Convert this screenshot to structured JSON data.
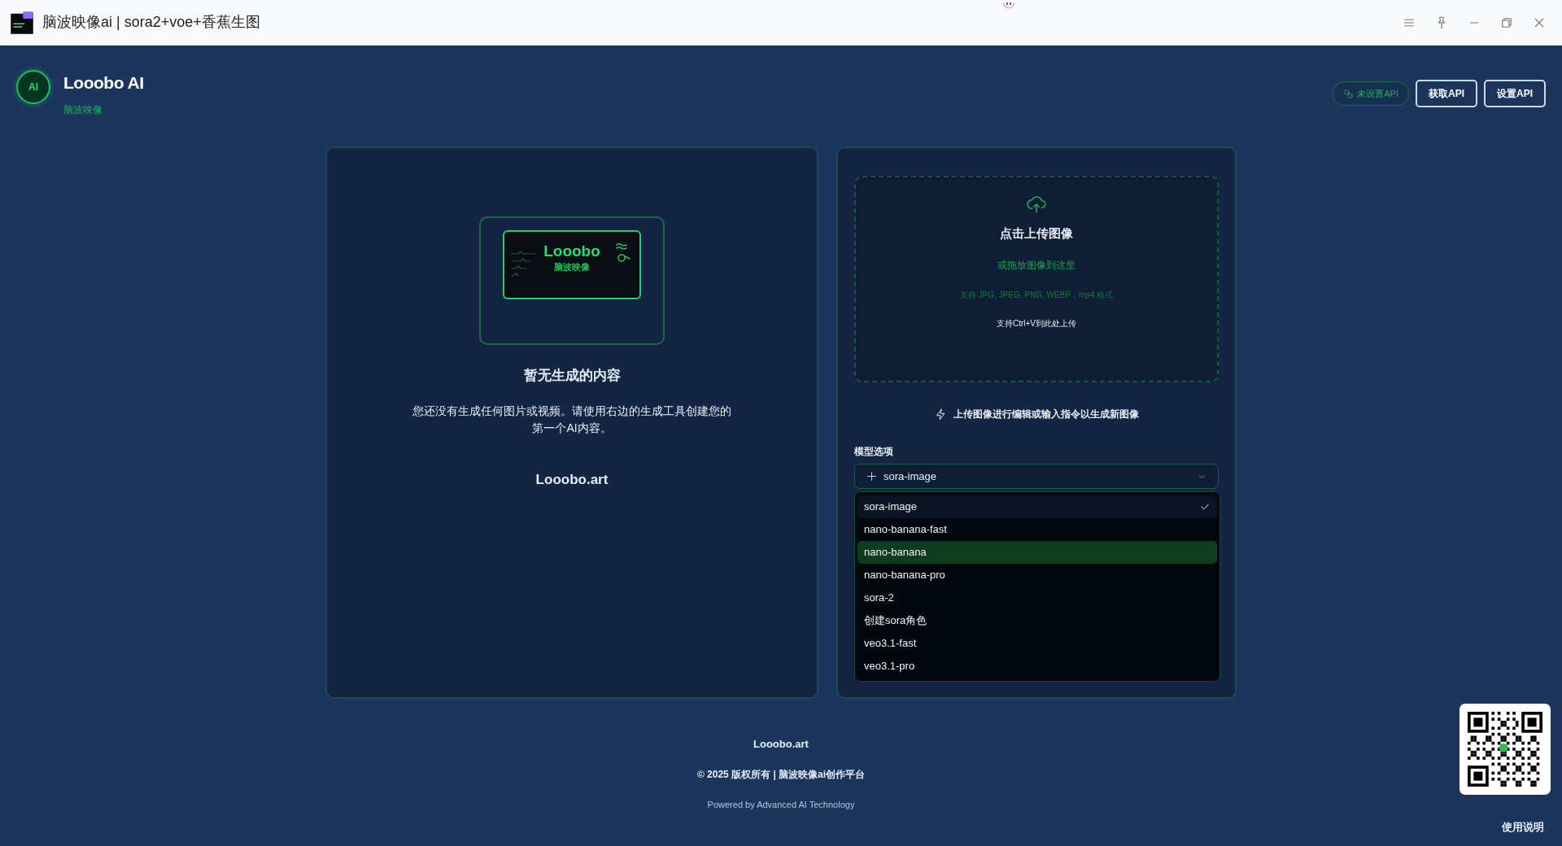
{
  "window": {
    "title": "脑波映像ai | sora2+voe+香蕉生图"
  },
  "header": {
    "logo_text": "AI",
    "title": "Looobo AI",
    "subtitle": "脑波映像",
    "api_status": "未设置API",
    "buttons": [
      "获取API",
      "设置API"
    ]
  },
  "gallery": {
    "logo": {
      "name": "Looobo",
      "tagline": "脑波映像"
    },
    "empty_title": "暂无生成的内容",
    "empty_text": "您还没有生成任何图片或视频。请使用右边的生成工具创建您的第一个AI内容。",
    "site": "Looobo.art"
  },
  "generator": {
    "upload": {
      "title": "点击上传图像",
      "drag_hint": "或拖放图像到这里",
      "formats": "支持 JPG, JPEG, PNG, WEBP，mp4 格式",
      "paste_hint": "支持Ctrl+V到此处上传"
    },
    "instruction": "上传图像进行编辑或输入指令以生成新图像",
    "model_label": "模型选项",
    "model_value": "sora-image",
    "model_options": [
      {
        "label": "sora-image",
        "selected": true,
        "highlighted": false
      },
      {
        "label": "nano-banana-fast",
        "selected": false,
        "highlighted": false
      },
      {
        "label": "nano-banana",
        "selected": false,
        "highlighted": true
      },
      {
        "label": "nano-banana-pro",
        "selected": false,
        "highlighted": false
      },
      {
        "label": "sora-2",
        "selected": false,
        "highlighted": false
      },
      {
        "label": "创建sora角色",
        "selected": false,
        "highlighted": false
      },
      {
        "label": "veo3.1-fast",
        "selected": false,
        "highlighted": false
      },
      {
        "label": "veo3.1-pro",
        "selected": false,
        "highlighted": false
      }
    ]
  },
  "footer": {
    "site": "Looobo.art",
    "copyright": "© 2025 版权所有 | 脑波映像ai创作平台",
    "powered": "Powered by Advanced AI Technology"
  },
  "help_button": "使用说明"
}
